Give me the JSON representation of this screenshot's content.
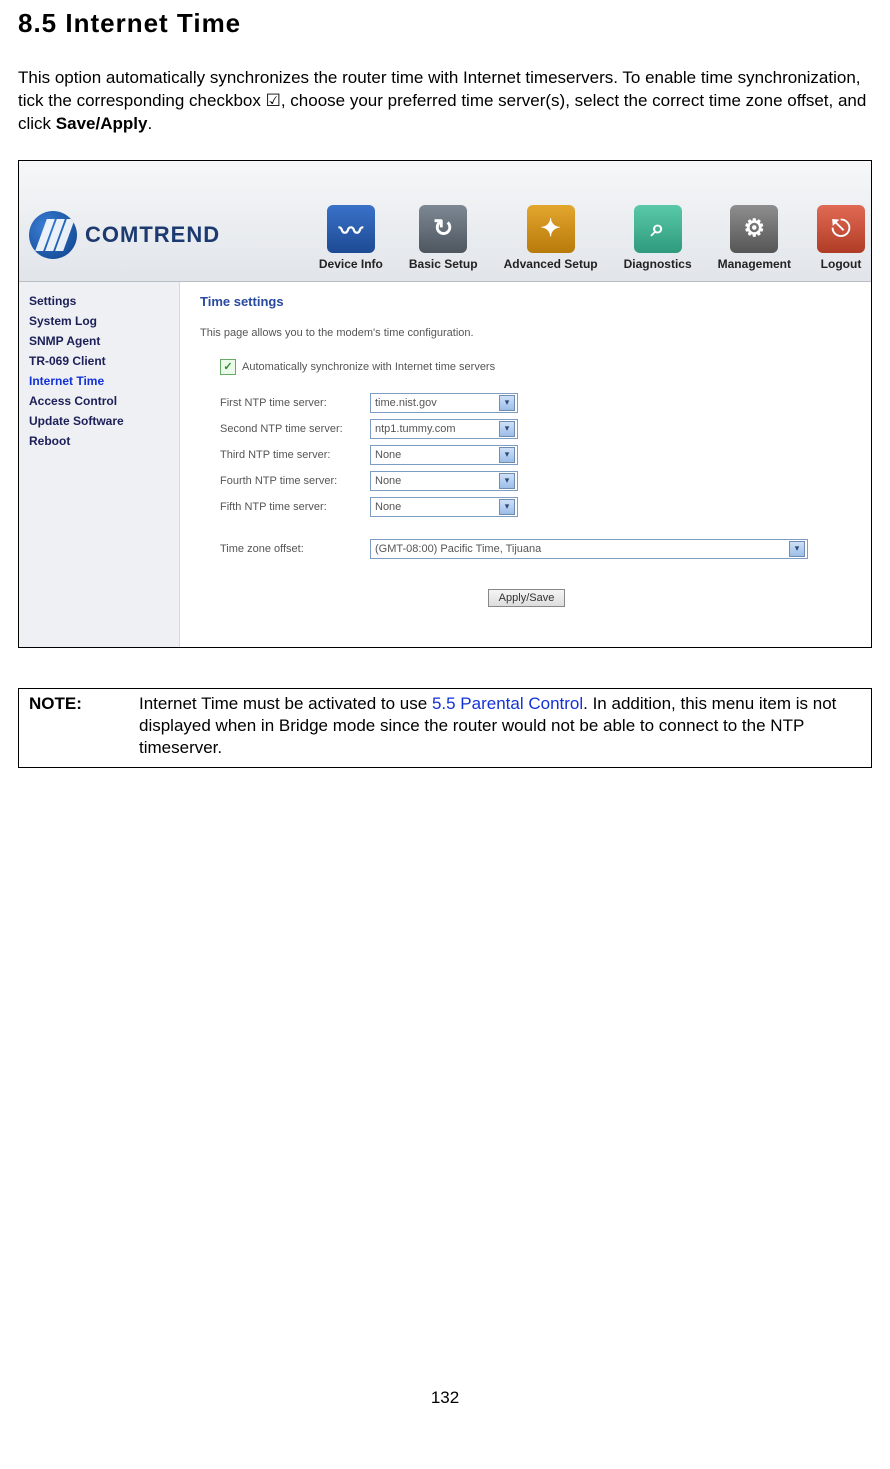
{
  "heading": "8.5 Internet Time",
  "intro_text_1": "This option automatically synchronizes the router time with Internet timeservers. To enable time synchronization, tick the corresponding checkbox ",
  "intro_checkbox_glyph": "☑",
  "intro_text_2": ", choose your preferred time server(s), select the correct time zone offset, and click ",
  "intro_bold": "Save/Apply",
  "intro_text_3": ".",
  "screenshot": {
    "logo_text": "COMTREND",
    "nav": [
      {
        "label": "Device Info"
      },
      {
        "label": "Basic Setup"
      },
      {
        "label": "Advanced Setup"
      },
      {
        "label": "Diagnostics"
      },
      {
        "label": "Management"
      },
      {
        "label": "Logout"
      }
    ],
    "sidebar": {
      "items": [
        {
          "label": "Settings",
          "active": false
        },
        {
          "label": "System Log",
          "active": false
        },
        {
          "label": "SNMP Agent",
          "active": false
        },
        {
          "label": "TR-069 Client",
          "active": false
        },
        {
          "label": "Internet Time",
          "active": true
        },
        {
          "label": "Access Control",
          "active": false
        },
        {
          "label": "Update Software",
          "active": false
        },
        {
          "label": "Reboot",
          "active": false
        }
      ]
    },
    "panel": {
      "title": "Time settings",
      "desc": "This page allows you to the modem's time configuration.",
      "sync_checked": true,
      "sync_label": "Automatically synchronize with Internet time servers",
      "rows": [
        {
          "label": "First NTP time server:",
          "value": "time.nist.gov"
        },
        {
          "label": "Second NTP time server:",
          "value": "ntp1.tummy.com"
        },
        {
          "label": "Third NTP time server:",
          "value": "None"
        },
        {
          "label": "Fourth NTP time server:",
          "value": "None"
        },
        {
          "label": "Fifth NTP time server:",
          "value": "None"
        }
      ],
      "tz_label": "Time zone offset:",
      "tz_value": "(GMT-08:00) Pacific Time, Tijuana",
      "apply_button": "Apply/Save"
    }
  },
  "note": {
    "label": "NOTE:",
    "text_before_link": "Internet Time must be activated to use ",
    "link_text": "5.5 Parental Control",
    "text_after_link": ". In addition, this menu item is not displayed when in Bridge mode since the router would not be able to connect to the NTP timeserver."
  },
  "page_number": "132"
}
